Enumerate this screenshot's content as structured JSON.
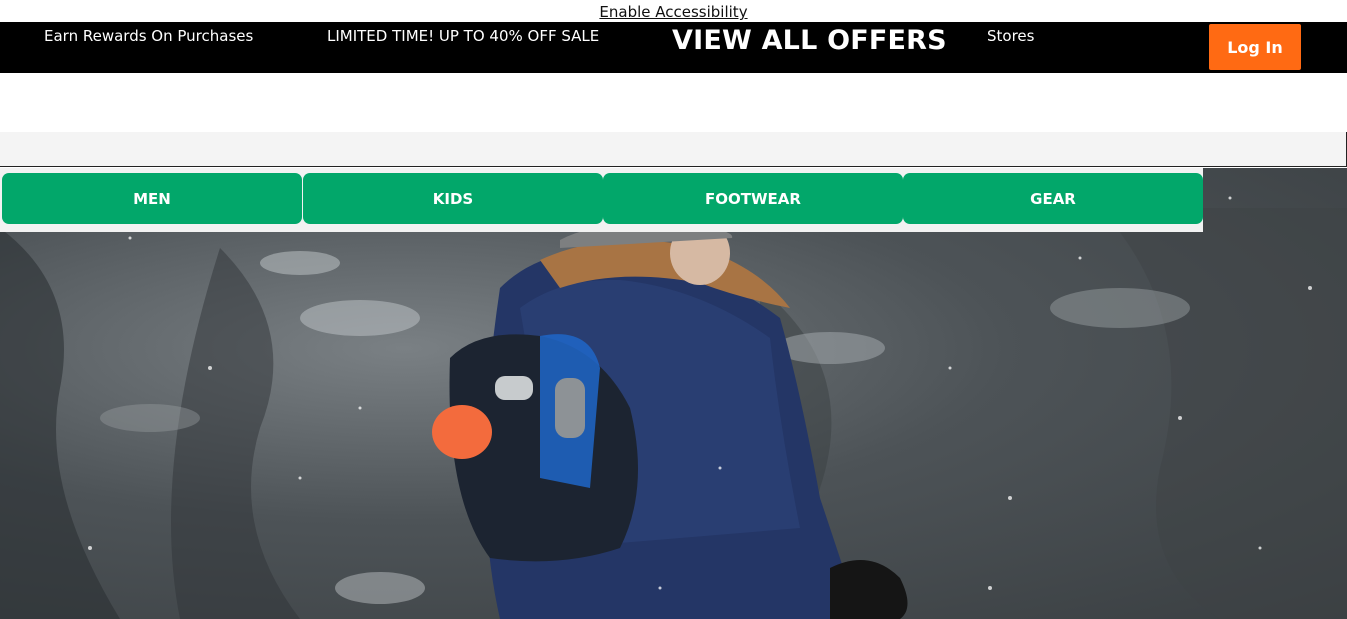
{
  "accessibility": {
    "link_label": "Enable Accessibility"
  },
  "promo_bar": {
    "rewards": "Earn Rewards On Purchases",
    "sale": "LIMITED TIME! UP TO 40% OFF SALE",
    "offers": "VIEW ALL OFFERS",
    "stores": "Stores",
    "login": "Log In"
  },
  "categories": [
    {
      "label": "MEN"
    },
    {
      "label": "KIDS"
    },
    {
      "label": "FOOTWEAR"
    },
    {
      "label": "GEAR"
    }
  ],
  "colors": {
    "promo_background": "#000000",
    "login_button": "#ff6a13",
    "category_button": "#02a76a"
  },
  "hero": {
    "image": "person-in-snow-with-backpack"
  }
}
